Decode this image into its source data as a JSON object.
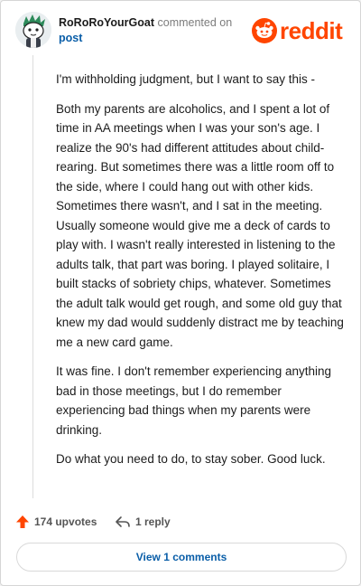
{
  "comment": {
    "author": "RoRoRoYourGoat",
    "action": "commented on",
    "target_link": "post",
    "paragraphs": [
      "I'm withholding judgment, but I want to say this -",
      "Both my parents are alcoholics, and I spent a lot of time in AA meetings when I was your son's age. I realize the 90's had different attitudes about child-rearing. But sometimes there was a little room off to the side, where I could hang out with other kids. Sometimes there wasn't, and I sat in the meeting. Usually someone would give me a deck of cards to play with. I wasn't really interested in listening to the adults talk, that part was boring. I played solitaire, I built stacks of sobriety chips, whatever. Sometimes the adult talk would get rough, and some old guy that knew my dad would suddenly distract me by teaching me a new card game.",
      "It was fine. I don't remember experiencing anything bad in those meetings, but I do remember experiencing bad things when my parents were drinking.",
      "Do what you need to do, to stay sober. Good luck."
    ]
  },
  "brand": {
    "name": "reddit",
    "icon": "reddit-alien-icon",
    "color": "#ff4500"
  },
  "actions": {
    "upvotes_label": "174 upvotes",
    "upvote_icon": "upvote-arrow-icon",
    "upvote_color": "#ff4500",
    "replies_label": "1 reply",
    "reply_icon": "reply-arrow-icon"
  },
  "view_comments_label": "View 1 comments",
  "link_color": "#0a5ea8"
}
